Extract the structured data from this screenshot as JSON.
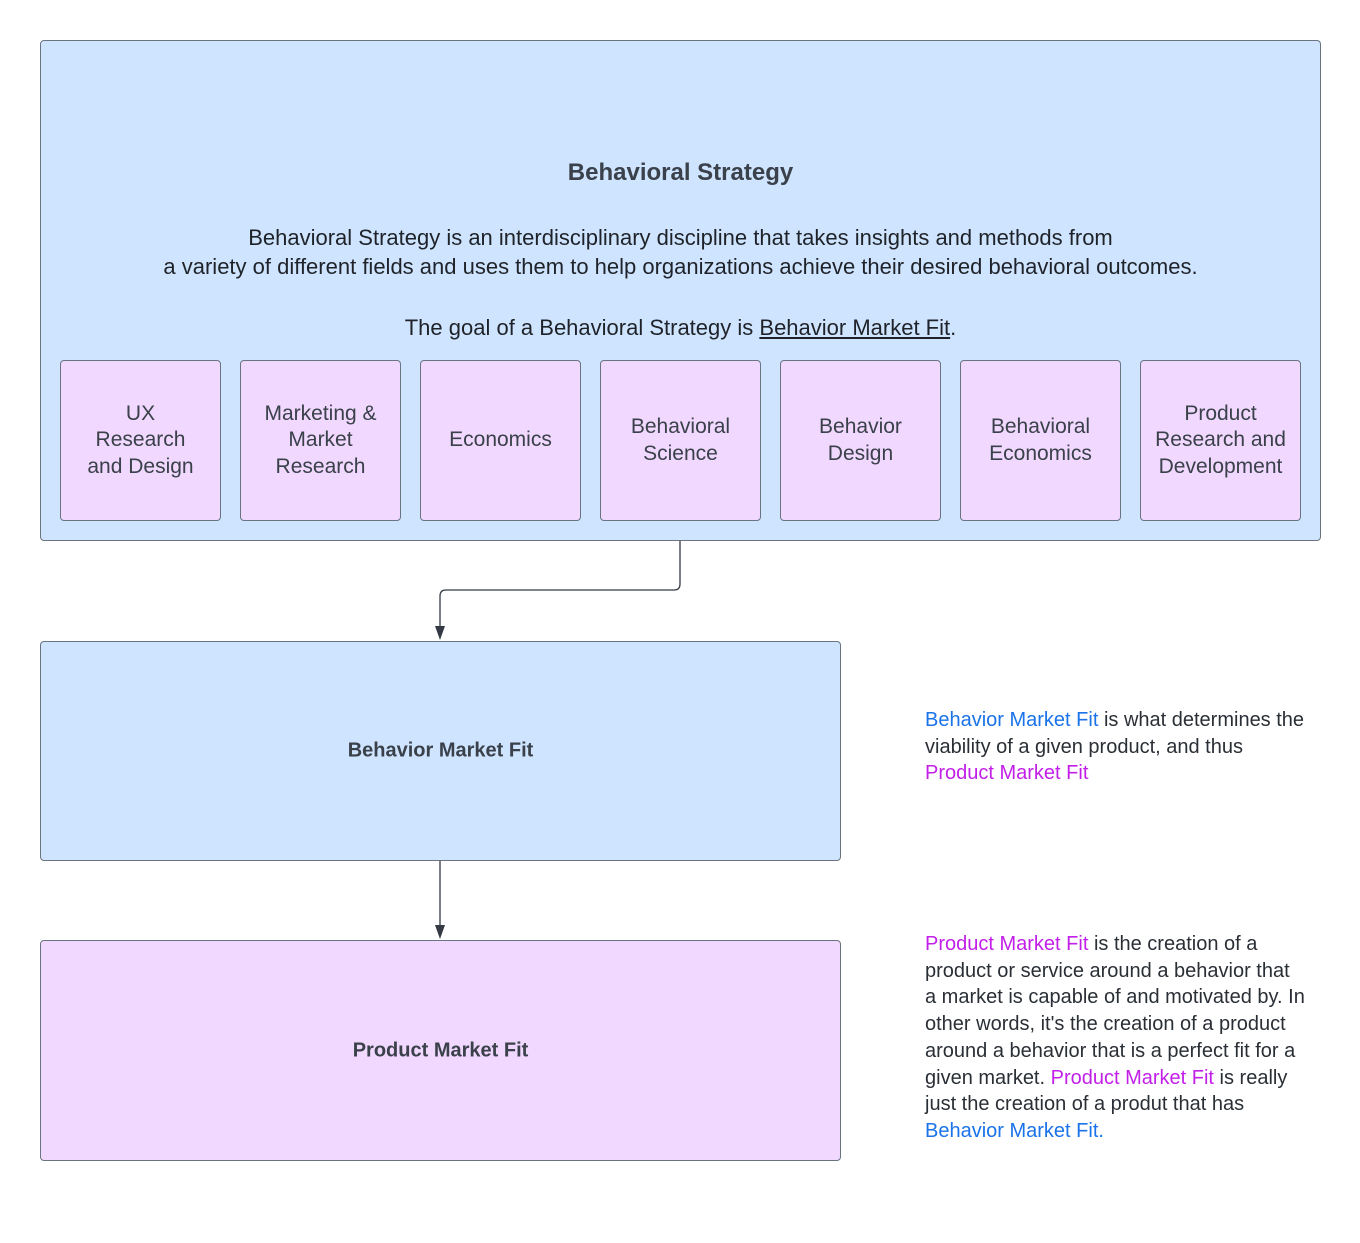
{
  "strategy": {
    "title": "Behavioral Strategy",
    "description_line1": "Behavioral Strategy is an interdisciplinary discipline that takes insights and methods from",
    "description_line2": "a variety of different fields and uses them to help organizations achieve their desired behavioral outcomes.",
    "goal_prefix": "The goal of a Behavioral Strategy is ",
    "goal_link": "Behavior Market Fit",
    "goal_suffix": ".",
    "disciplines": [
      {
        "label": "UX\nResearch\nand Design"
      },
      {
        "label": "Marketing &\nMarket\nResearch"
      },
      {
        "label": "Economics"
      },
      {
        "label": "Behavioral\nScience"
      },
      {
        "label": "Behavior\nDesign"
      },
      {
        "label": "Behavioral\nEconomics"
      },
      {
        "label": "Product\nResearch and\nDevelopment"
      }
    ]
  },
  "behavior_market_fit": {
    "label": "Behavior Market Fit"
  },
  "product_market_fit": {
    "label": "Product Market Fit"
  },
  "notes": {
    "note1": {
      "term1": "Behavior Market Fit",
      "text1": " is what determines the viability of a given product, and thus ",
      "term2": "Product Market Fit"
    },
    "note2": {
      "term1": "Product Market Fit",
      "text1": " is the creation of a product or service around a behavior that a market is capable of and motivated by. In other words, it's the creation of a product around a behavior that is a perfect fit for a given market. ",
      "term2": "Product Market Fit",
      "text2": " is really just the creation of a produt that has ",
      "term3": "Behavior Market Fit."
    }
  },
  "colors": {
    "blue_fill": "#cfe4ff",
    "pink_fill": "#f1d8fe",
    "blue_term": "#1a73e8",
    "purple_term": "#c21fe8",
    "stroke": "#6a7480"
  }
}
